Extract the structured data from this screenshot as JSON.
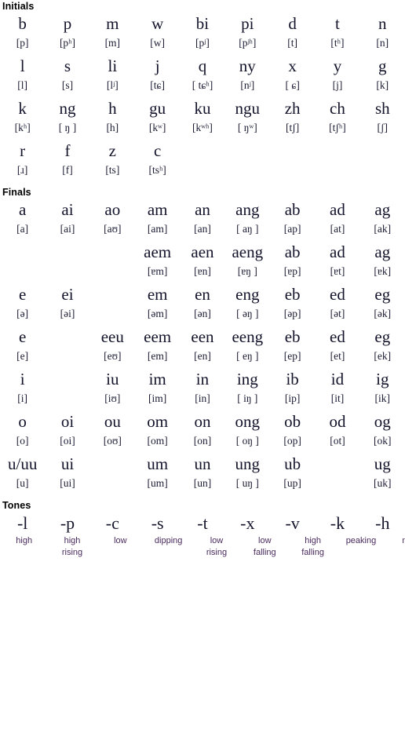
{
  "sections": {
    "initials": {
      "header": "Initials",
      "rows": [
        {
          "letters": [
            "b",
            "p",
            "m",
            "w",
            "bi",
            "pi",
            "d",
            "t",
            "n"
          ],
          "ipa": [
            "[p]",
            "[pʰ]",
            "[m]",
            "[w]",
            "[pʲ]",
            "[pʲʰ]",
            "[t]",
            "[tʰ]",
            "[n]"
          ]
        },
        {
          "letters": [
            "l",
            "s",
            "li",
            "j",
            "q",
            "ny",
            "x",
            "y",
            "g"
          ],
          "ipa": [
            "[l]",
            "[s]",
            "[lʲ]",
            "[tɕ]",
            "[ tɕʰ]",
            "[nʲ]",
            "[ ɕ]",
            "[j]",
            "[k]"
          ]
        },
        {
          "letters": [
            "k",
            "ng",
            "h",
            "gu",
            "ku",
            "ngu",
            "zh",
            "ch",
            "sh"
          ],
          "ipa": [
            "[kʰ]",
            "[ ŋ ]",
            "[h]",
            "[kʷ]",
            "[kʷʰ]",
            "[ ŋʷ]",
            "[tʃ]",
            "[tʃʰ]",
            "[ʃ]"
          ]
        },
        {
          "letters": [
            "r",
            "f",
            "z",
            "c",
            "",
            "",
            "",
            "",
            ""
          ],
          "ipa": [
            "[ɹ]",
            "[f]",
            "[ts]",
            "[tsʰ]",
            "",
            "",
            "",
            "",
            ""
          ]
        }
      ]
    },
    "finals": {
      "header": "Finals",
      "rows": [
        {
          "letters": [
            "a",
            "ai",
            "ao",
            "am",
            "an",
            "ang",
            "ab",
            "ad",
            "ag"
          ],
          "ipa": [
            "[a]",
            "[ai]",
            "[aʊ]",
            "[am]",
            "[an]",
            "[ aŋ ]",
            "[ap]",
            "[at]",
            "[ak]"
          ]
        },
        {
          "letters": [
            "",
            "",
            "",
            "aem",
            "aen",
            "aeng",
            "ab",
            "ad",
            "ag"
          ],
          "ipa": [
            "",
            "",
            "",
            "[ɐm]",
            "[ɐn]",
            "[ɐŋ ]",
            "[ɐp]",
            "[ɐt]",
            "[ɐk]"
          ]
        },
        {
          "letters": [
            "e",
            "ei",
            "",
            "em",
            "en",
            "eng",
            "eb",
            "ed",
            "eg"
          ],
          "ipa": [
            "[ə]",
            "[əi]",
            "",
            "[əm]",
            "[ən]",
            "[ əŋ ]",
            "[əp]",
            "[ət]",
            "[ək]"
          ]
        },
        {
          "letters": [
            "e",
            "",
            "eeu",
            "eem",
            "een",
            "eeng",
            "eb",
            "ed",
            "eg"
          ],
          "ipa": [
            "[e]",
            "",
            "[eʊ]",
            "[em]",
            "[en]",
            "[ eŋ ]",
            "[ep]",
            "[et]",
            "[ek]"
          ]
        },
        {
          "letters": [
            "i",
            "",
            "iu",
            "im",
            "in",
            "ing",
            "ib",
            "id",
            "ig"
          ],
          "ipa": [
            "[i]",
            "",
            "[iʊ]",
            "[im]",
            "[in]",
            "[ iŋ ]",
            "[ip]",
            "[it]",
            "[ik]"
          ]
        },
        {
          "letters": [
            "o",
            "oi",
            "ou",
            "om",
            "on",
            "ong",
            "ob",
            "od",
            "og"
          ],
          "ipa": [
            "[o]",
            "[oi]",
            "[oʊ]",
            "[om]",
            "[on]",
            "[ oŋ ]",
            "[op]",
            "[ot]",
            "[ok]"
          ]
        },
        {
          "letters": [
            "u/uu",
            "ui",
            "",
            "um",
            "un",
            "ung",
            "ub",
            "",
            "ug"
          ],
          "ipa": [
            "[u]",
            "[ui]",
            "",
            "[um]",
            "[un]",
            "[ uŋ ]",
            "[up]",
            "",
            "[uk]"
          ]
        }
      ]
    },
    "tones": {
      "header": "Tones",
      "marks": [
        "-l",
        "-p",
        "-c",
        "-s",
        "-t",
        "-x",
        "-v",
        "-k",
        "-h"
      ],
      "descriptions": [
        [
          "high"
        ],
        [
          "high",
          "rising"
        ],
        [
          "low"
        ],
        [
          "dipping"
        ],
        [
          "low",
          "rising"
        ],
        [
          "low",
          "falling"
        ],
        [
          "high",
          "falling"
        ],
        [
          "peaking"
        ],
        [
          "mid"
        ]
      ]
    }
  },
  "colors": {
    "header_text": "#000000",
    "letter_text": "#13132b",
    "ipa_text": "#1b1b33",
    "tone_description_text": "#4a2a5e",
    "background": "#ffffff"
  }
}
